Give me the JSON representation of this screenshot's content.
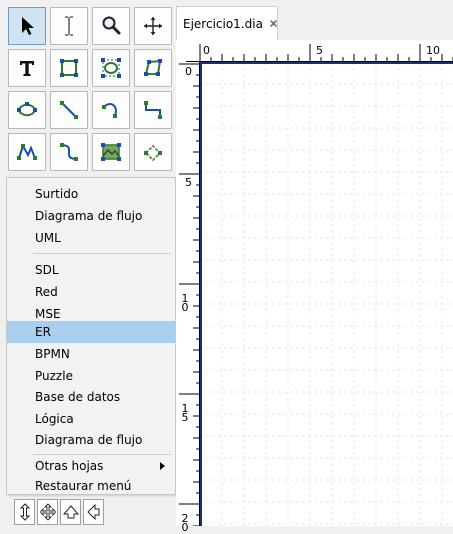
{
  "document": {
    "tab_title": "Ejercicio1.dia",
    "close_icon": "close-x-icon",
    "hruler_labels": [
      "0",
      "5",
      "10"
    ],
    "vruler_labels": [
      "0",
      "5",
      "10",
      "15",
      "20"
    ]
  },
  "toolbox": {
    "tools": [
      {
        "name": "pointer-tool",
        "icon": "pointer-arrow-icon",
        "selected": true
      },
      {
        "name": "text-edit-tool",
        "icon": "text-cursor-icon"
      },
      {
        "name": "magnify-tool",
        "icon": "magnify-icon"
      },
      {
        "name": "scroll-tool",
        "icon": "move-arrows-icon"
      },
      {
        "name": "text-tool",
        "icon": "text-t-icon"
      },
      {
        "name": "box-tool",
        "icon": "box-icon"
      },
      {
        "name": "ellipse-tool",
        "icon": "ellipse-icon"
      },
      {
        "name": "polygon-tool",
        "icon": "polygon-icon"
      },
      {
        "name": "beziergon-tool",
        "icon": "beziergon-icon"
      },
      {
        "name": "line-tool",
        "icon": "line-icon"
      },
      {
        "name": "arc-tool",
        "icon": "arc-icon"
      },
      {
        "name": "zigzag-tool",
        "icon": "zigzag-icon"
      },
      {
        "name": "polyline-tool",
        "icon": "polyline-icon"
      },
      {
        "name": "bezierline-tool",
        "icon": "bezierline-icon"
      },
      {
        "name": "image-tool",
        "icon": "image-icon"
      },
      {
        "name": "outline-tool",
        "icon": "outline-icon"
      }
    ]
  },
  "sheets_menu": {
    "group1": [
      "Surtido",
      "Diagrama de flujo",
      "UML"
    ],
    "group2": [
      "SDL",
      "Red",
      "MSE",
      "ER",
      "BPMN",
      "Puzzle",
      "Base de datos",
      "Lógica",
      "Diagrama de flujo"
    ],
    "group3": [
      "Otras hojas",
      "Restaurar menú"
    ],
    "highlighted": "ER",
    "highlight_color": "#a9cfee"
  },
  "arrow_buttons": [
    {
      "name": "arrow-vertical-button",
      "icon": "double-arrow-vertical-icon"
    },
    {
      "name": "arrow-four-way-button",
      "icon": "four-way-arrow-icon"
    },
    {
      "name": "arrow-up-button",
      "icon": "arrow-up-outline-icon"
    },
    {
      "name": "arrow-left-button",
      "icon": "arrow-left-outline-icon"
    }
  ],
  "colors": {
    "grid_line": "#dfe8ee",
    "canvas_border": "#1c2f6e",
    "selected_tool": "#cfe3f4"
  }
}
